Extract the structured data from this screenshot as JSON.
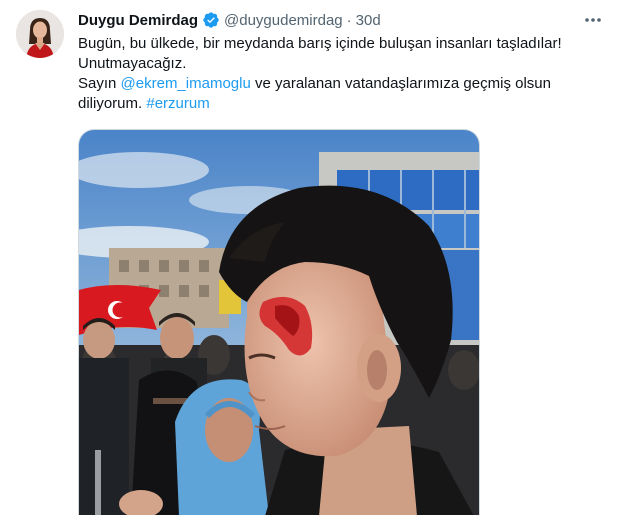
{
  "tweet": {
    "author_name": "Duygu Demirdag",
    "handle": "@duygudemirdag",
    "separator": "·",
    "time": "30d",
    "verified": true,
    "line1": "Bugün, bu ülkede, bir meydanda barış içinde buluşan insanları taşladılar!",
    "line2": "Unutmayacağız.",
    "line3_prefix": "Sayın ",
    "mention": "@ekrem_imamoglu",
    "line3_mid": " ve yaralanan vatandaşlarımıza geçmiş olsun",
    "line4_prefix": "diliyorum. ",
    "hashtag": "#erzurum",
    "icons": {
      "verified": "verified-badge-icon",
      "more": "more-options-icon"
    },
    "colors": {
      "link": "#1d9bf0",
      "verified": "#1d9bf0",
      "secondary_text": "#536471"
    }
  }
}
